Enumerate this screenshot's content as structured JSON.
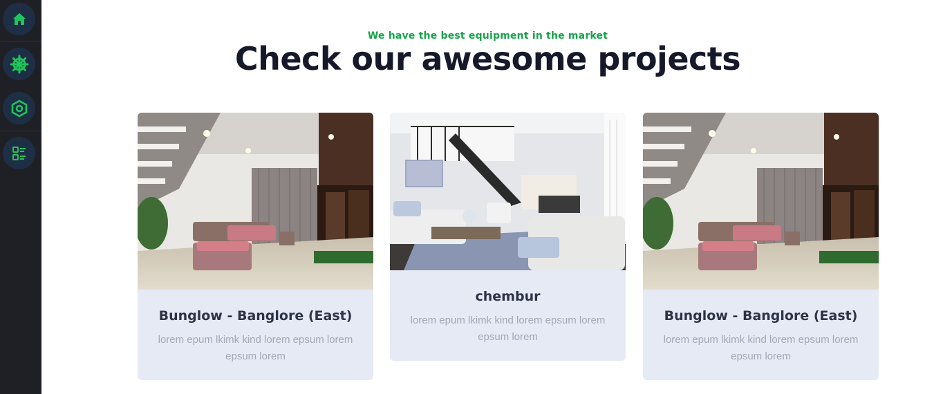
{
  "sidebar": {
    "items": [
      {
        "icon": "home-icon",
        "label": "Home"
      },
      {
        "icon": "helm-icon",
        "label": "Projects"
      },
      {
        "icon": "hexagon-icon",
        "label": "Services"
      },
      {
        "icon": "list-icon",
        "label": "Dashboard"
      }
    ],
    "accent_color": "#1fc45a"
  },
  "header": {
    "subtitle": "We have the best equipment in the market",
    "title": "Check our awesome projects"
  },
  "projects": [
    {
      "title": "Bunglow - Banglore (East)",
      "description": "lorem epum lkimk kind lorem epsum lorem epsum lorem",
      "image": "living-room-staircase-photo"
    },
    {
      "title": "chembur",
      "description": "lorem epum lkimk kind lorem epsum lorem epsum lorem",
      "image": "white-living-room-photo"
    },
    {
      "title": "Bunglow - Banglore (East)",
      "description": "lorem epum lkimk kind lorem epsum lorem epsum lorem",
      "image": "living-room-staircase-photo"
    }
  ]
}
